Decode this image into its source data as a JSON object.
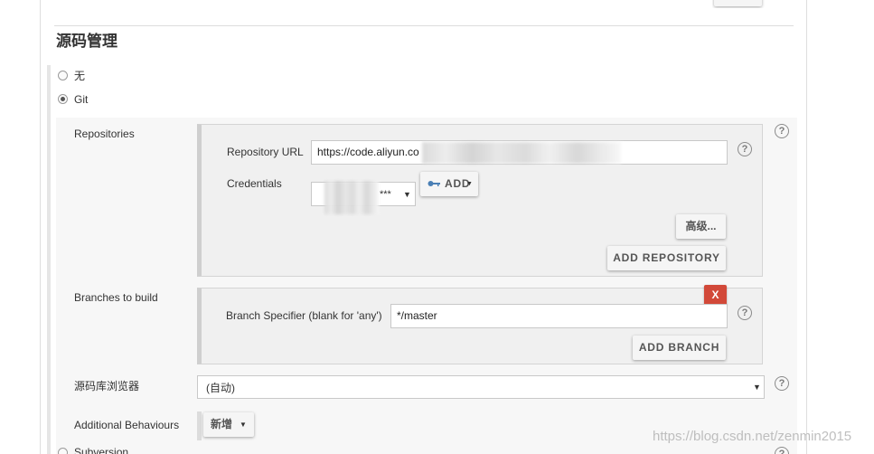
{
  "section": {
    "title": "源码管理"
  },
  "scm_options": [
    {
      "label": "无",
      "checked": false
    },
    {
      "label": "Git",
      "checked": true
    },
    {
      "label": "Subversion",
      "checked": false
    }
  ],
  "repositories": {
    "label": "Repositories",
    "url_label": "Repository URL",
    "url_value": "https://code.aliyun.co",
    "credentials_label": "Credentials",
    "credentials_value": "***",
    "add_button_label": "ADD",
    "advanced_button_label": "高级...",
    "add_repository_label": "ADD REPOSITORY"
  },
  "branches": {
    "label": "Branches to build",
    "specifier_label": "Branch Specifier (blank for 'any')",
    "specifier_value": "*/master",
    "delete_label": "X",
    "add_branch_label": "ADD BRANCH"
  },
  "repo_browser": {
    "label": "源码库浏览器",
    "value": "(自动)"
  },
  "additional_behaviours": {
    "label": "Additional Behaviours",
    "button_label": "新增"
  },
  "glyphs": {
    "help": "?",
    "caret": "▼"
  },
  "watermark": "https://blog.csdn.net/zenmin2015",
  "colors": {
    "delete": "#d24939",
    "panel": "#f0f0f0",
    "region": "#f7f7f7",
    "border": "#d4d4d4"
  }
}
